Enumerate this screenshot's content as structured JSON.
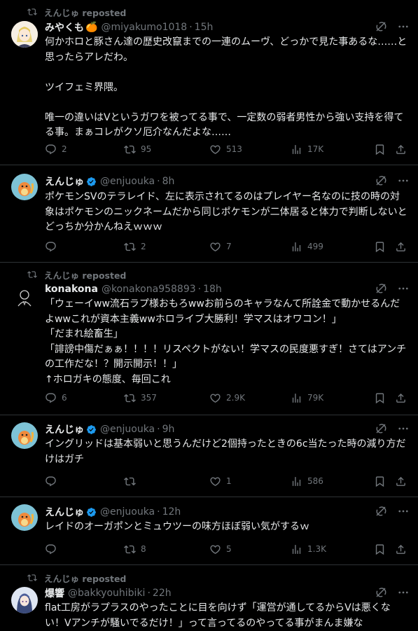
{
  "tweets": [
    {
      "repost_label": "えんじゅ reposted",
      "name": "みやくも",
      "name_emoji": "🍊",
      "handle": "@miyakumo1018",
      "time": "15h",
      "text": "何かホロと豚さん達の歴史改竄までの一連のムーヴ、どっかで見た事あるな……と思ったらアレだわ。\n\nツイフェミ界隈。\n\n唯一の違いはVというガワを被ってる事で、一定数の弱者男性から強い支持を得てる事。まぁコレがクソ厄介なんだよな……",
      "replies": "2",
      "reposts": "95",
      "likes": "513",
      "views": "17K"
    },
    {
      "name": "えんじゅ",
      "verified": true,
      "handle": "@enjuouka",
      "time": "8h",
      "text": "ポケモンSVのテラレイド、左に表示されてるのはプレイヤー名なのに技の時の対象はポケモンのニックネームだから同じポケモンが二体居ると体力で判断しないとどっちか分かんねえｗｗｗ",
      "replies": "",
      "reposts": "2",
      "likes": "7",
      "views": "499"
    },
    {
      "repost_label": "えんじゅ reposted",
      "name": "konakona",
      "handle": "@konakona958893",
      "time": "18h",
      "text": "「ウェーイww流石ラプ様おもろwwお前らのキャラなんて所詮金で動かせるんだよwwこれが資本主義wwホロライブ大勝利！学マスはオワコン！」\n「だまれ絵畜生」\n「誹謗中傷だぁぁ！！！！リスペクトがない！学マスの民度悪すぎ！さてはアンチの工作だな！？開示開示！！」\n↑ホロガキの態度、毎回これ",
      "replies": "6",
      "reposts": "357",
      "likes": "2.9K",
      "views": "79K"
    },
    {
      "name": "えんじゅ",
      "verified": true,
      "handle": "@enjuouka",
      "time": "9h",
      "text": "イングリッドは基本弱いと思うんだけど2個持ったときの6c当たった時の減り方だけはガチ",
      "replies": "",
      "reposts": "",
      "likes": "1",
      "views": "586"
    },
    {
      "name": "えんじゅ",
      "verified": true,
      "handle": "@enjuouka",
      "time": "12h",
      "text": "レイドのオーガポンとミュウツーの味方ほぼ弱い気がするｗ",
      "replies": "",
      "reposts": "8",
      "likes": "5",
      "views": "1.3K"
    },
    {
      "repost_label": "えんじゅ reposted",
      "name": "爆響",
      "handle": "@bakkyouhibiki",
      "time": "22h",
      "text": "flat工房がラプラスのやったことに目を向けず「運営が通してるからVは悪くない！Vアンチが騒いでるだけ！」って言ってるのやってる事がまんま嫌な"
    }
  ],
  "colors": {
    "bg": "#000000",
    "text": "#e7e9ea",
    "muted": "#71767b",
    "border": "#2f3336",
    "verified": "#1d9bf0"
  },
  "icons": [
    "repost-icon",
    "verified-badge-icon",
    "grok-icon",
    "more-icon",
    "reply-icon",
    "retweet-icon",
    "like-icon",
    "views-icon",
    "bookmark-icon",
    "share-icon"
  ]
}
